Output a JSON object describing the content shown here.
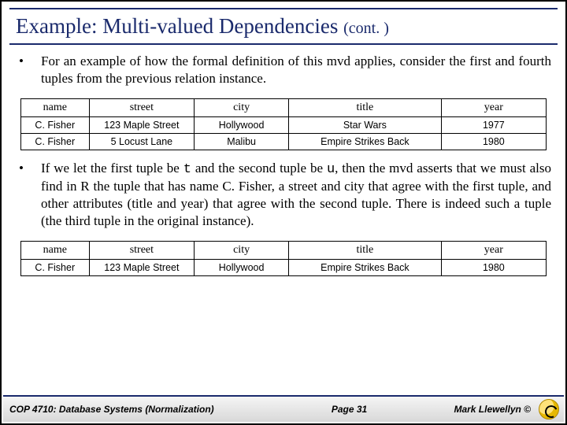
{
  "title_main": "Example: Multi-valued Dependencies ",
  "title_cont": "(cont. )",
  "para1": "For an example of how the formal definition of this mvd applies, consider the first and fourth tuples from the previous relation instance.",
  "para2a": "If we let the first tuple be ",
  "para2t": "t",
  "para2b": " and the second tuple be ",
  "para2u": "u",
  "para2c": ", then the mvd asserts that we must also find in R the tuple that has name C. Fisher, a street and city that agree with the first tuple, and other attributes (title and year) that agree with the second tuple.  There is indeed such a tuple (the third tuple in the original instance).",
  "headers": {
    "name": "name",
    "street": "street",
    "city": "city",
    "title": "title",
    "year": "year"
  },
  "table1": [
    {
      "name": "C. Fisher",
      "street": "123 Maple Street",
      "city": "Hollywood",
      "title": "Star Wars",
      "year": "1977"
    },
    {
      "name": "C. Fisher",
      "street": "5 Locust Lane",
      "city": "Malibu",
      "title": "Empire Strikes Back",
      "year": "1980"
    }
  ],
  "table2": [
    {
      "name": "C. Fisher",
      "street": "123 Maple Street",
      "city": "Hollywood",
      "title": "Empire Strikes Back",
      "year": "1980"
    }
  ],
  "footer": {
    "course": "COP 4710: Database Systems  (Normalization)",
    "page": "Page 31",
    "author": "Mark Llewellyn ©"
  }
}
